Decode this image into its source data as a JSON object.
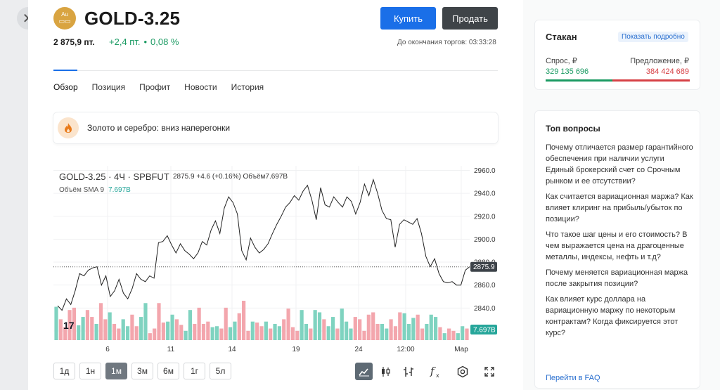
{
  "close_label": "✕",
  "header": {
    "badge_text": "Au",
    "ticker": "GOLD-3.25",
    "buy_label": "Купить",
    "sell_label": "Продать",
    "price": "2 875,9 пт.",
    "change_points": "+2,4 пт.",
    "change_percent": "0,08 %",
    "trade_end": "До окончания торгов: 03:33:28"
  },
  "tabs": [
    "Обзор",
    "Позиция",
    "Профит",
    "Новости",
    "История"
  ],
  "news": {
    "text": "Золото и серебро: вниз наперегонки"
  },
  "chart": {
    "title": "GOLD-3.25 · 4Ч · SPBFUT",
    "ohlc": "2875.9  +4.6 (+0.16%)  Объём7.697B",
    "vol_label": "Объём SMA 9",
    "vol_value": "7.697B",
    "price_tag": "2875.9",
    "volume_tag": "7.697B",
    "logo_text": "17"
  },
  "chart_data": {
    "type": "line",
    "y_tick_labels": [
      "2960.0",
      "2940.0",
      "2920.0",
      "2900.0",
      "2880.0",
      "2860.0",
      "2840.0",
      "2820.0"
    ],
    "ylim": [
      2812,
      2964
    ],
    "x_tick_labels": [
      "6",
      "11",
      "14",
      "19",
      "24",
      "12:00",
      "Мар"
    ],
    "last_value": 2875.9,
    "series": [
      {
        "values": [
          2842,
          2838,
          2848,
          2843,
          2855,
          2870,
          2868,
          2873,
          2875,
          2876,
          2860,
          2868,
          2850,
          2855,
          2865,
          2853,
          2848,
          2857,
          2870,
          2865,
          2863,
          2868,
          2866,
          2897,
          2898,
          2903,
          2895,
          2888,
          2896,
          2890,
          2887,
          2883,
          2888,
          2898,
          2895,
          2908,
          2916,
          2905,
          2927,
          2937,
          2932,
          2922,
          2890,
          2882,
          2901,
          2893,
          2888,
          2891,
          2896,
          2905,
          2913,
          2920,
          2928,
          2932,
          2938,
          2934,
          2942,
          2947,
          2934,
          2917,
          2945,
          2930,
          2928,
          2937,
          2932,
          2928,
          2937,
          2933,
          2922,
          2932,
          2948,
          2938,
          2952,
          2940,
          2925,
          2918,
          2917,
          2893,
          2913,
          2917,
          2915,
          2913,
          2918,
          2905,
          2885,
          2876,
          2883,
          2870,
          2863,
          2862,
          2863,
          2860,
          2860,
          2873,
          2876
        ]
      }
    ],
    "volume": {
      "values": [
        7.2,
        4.5,
        2.8,
        6.5,
        7,
        3.2,
        5,
        6.5,
        5,
        3.5,
        8,
        4.5,
        6,
        3.5,
        2.5,
        4.5,
        3,
        5.5,
        3,
        5,
        8,
        1.5,
        2.5,
        8,
        3.8,
        4,
        5.5,
        4.5,
        3.3,
        2,
        6.5,
        3.5,
        7,
        3.5,
        4,
        2.8,
        3,
        2.5,
        7,
        2.8,
        4,
        5.8,
        8.5,
        2,
        4,
        3.8,
        3,
        4,
        2.5,
        3.5,
        3,
        4.5,
        6.8,
        2.8,
        2,
        6.5,
        3.5,
        2.5,
        6.5,
        6,
        4.5,
        3,
        5,
        2.5,
        6.8,
        4,
        2.5,
        5,
        4.5,
        2,
        5.5,
        6,
        3.5,
        3.5,
        2.5,
        4.5,
        3,
        6,
        5.8,
        3.5,
        4.8,
        5.5,
        2.5,
        3.5,
        5.5,
        5,
        2.8,
        1.5,
        2.5,
        2,
        1.5,
        3,
        2.5
      ],
      "direction": "udddduudduddudduudduudddduudduudddduudduudddudduduudddduuduuduuduuudddddduuddduuudduuududduudu"
    }
  },
  "intervals": [
    {
      "label": "1д",
      "active": false
    },
    {
      "label": "1н",
      "active": false
    },
    {
      "label": "1м",
      "active": true
    },
    {
      "label": "3м",
      "active": false
    },
    {
      "label": "6м",
      "active": false
    },
    {
      "label": "1г",
      "active": false
    },
    {
      "label": "5л",
      "active": false
    }
  ],
  "stakan": {
    "title": "Стакан",
    "show_more": "Показать подробно",
    "bid_label": "Спрос, ₽",
    "ask_label": "Предложение, ₽",
    "bid_value": "329 135 696",
    "ask_value": "384 424 689"
  },
  "faq": {
    "title": "Топ вопросы",
    "questions": [
      "Почему отличается размер гарантийного обеспечения при наличии услуги Единый брокерский счет со Срочным рынком и ее отсутствии?",
      "Как считается вариационная маржа? Как влияет клиринг на прибыль/убыток по позиции?",
      "Что такое шаг цены и его стоимость? В чем выражается цена на драгоценные металлы, индексы, нефть и т.д?",
      "Почему меняется вариационная маржа после закрытия позиции?",
      "Как влияет курс доллара на вариационную маржу по некоторым контрактам? Когда фиксируется этот курс?"
    ],
    "link": "Перейти в FAQ"
  },
  "colors": {
    "accent": "#1a6fe8",
    "up": "#1a9a62",
    "down": "#d64045",
    "volume_up": "#7fd3c0",
    "volume_down": "#f3a6ad"
  }
}
